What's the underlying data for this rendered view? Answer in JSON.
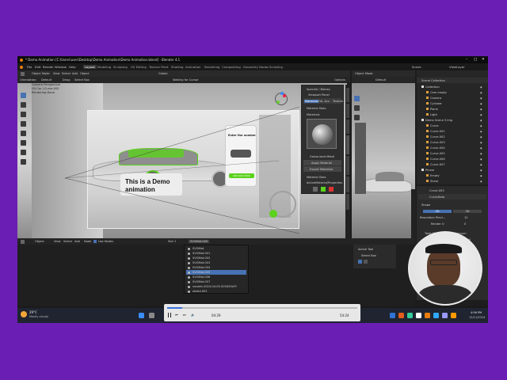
{
  "window": {
    "title": "* Demo Animation [C:\\Users\\user\\Desktop\\Demo Animation\\Demo Animation.blend] - Blender 4.1"
  },
  "menu": {
    "items": [
      "File",
      "Edit",
      "Render",
      "Window",
      "Help"
    ],
    "workspaces": [
      "Layout",
      "Modeling",
      "Sculpting",
      "UV Editing",
      "Texture Paint",
      "Shading",
      "Animation",
      "Rendering",
      "Compositing",
      "Geometry Nodes",
      "Scripting"
    ],
    "scene": "Scene",
    "view_layer": "ViewLayer"
  },
  "viewport": {
    "mode": "Object Mode",
    "menus": [
      "View",
      "Select",
      "Add",
      "Object"
    ],
    "transform": "Global",
    "orientation": "Orientation:",
    "default": "Default",
    "drag": "Drag:",
    "select": "Select Box",
    "overlay_label": "Camera Perspective",
    "collection_label": "(9) Car | Curve.005",
    "rendering": "Rendering Done",
    "waiting": "Waiting for Cursor",
    "options": "Options"
  },
  "scene_overlay": {
    "banner_line1": "This is a Demo",
    "banner_line2": "animation",
    "phone_title": "Enter the number",
    "phone_btn": "000 000 0000"
  },
  "sidebar": {
    "header": "Speckle / Blenso",
    "tabs": [
      "Materials",
      "Viewport Panel"
    ],
    "subtabs": [
      "Materials",
      "Ob. Acc.",
      "Texture"
    ],
    "rows": [
      "Material Slots",
      "Materials"
    ],
    "material_name": "Galvanized Metal",
    "apply": "Apply Material",
    "export": "Export Materials",
    "sections": [
      "Material Slots",
      "ActiveMaterial/Properties"
    ]
  },
  "vtabs": [
    "Item",
    "Tool",
    "View",
    "BlenderKit",
    "Polyhaven",
    "Speckle",
    "Blenso",
    "Create"
  ],
  "outliner": {
    "title": "Scene Collection",
    "items": [
      {
        "name": "Collection",
        "level": 0
      },
      {
        "name": "Cam empty",
        "level": 1
      },
      {
        "name": "Camera",
        "level": 1
      },
      {
        "name": "Cylinder",
        "level": 1
      },
      {
        "name": "Plane",
        "level": 1
      },
      {
        "name": "Light",
        "level": 1
      },
      {
        "name": "Demo Scene 3 Img",
        "level": 0
      },
      {
        "name": "Curve",
        "level": 1
      },
      {
        "name": "Curve.001",
        "level": 1
      },
      {
        "name": "Curve.002",
        "level": 1
      },
      {
        "name": "Curve.003",
        "level": 1
      },
      {
        "name": "Curve.004",
        "level": 1
      },
      {
        "name": "Curve.005",
        "level": 1
      },
      {
        "name": "Curve.006",
        "level": 1
      },
      {
        "name": "Curve.007",
        "level": 1
      },
      {
        "name": "Phone",
        "level": 0
      },
      {
        "name": "Empty",
        "level": 1
      },
      {
        "name": "Shear",
        "level": 1
      }
    ]
  },
  "props": {
    "object": "Curve.005",
    "data": "CurveData",
    "shape": "Shape",
    "fields": [
      {
        "label": "2D",
        "value": "3D"
      },
      {
        "label": "Resolution Previ...",
        "value": "12"
      },
      {
        "label": "Render U",
        "value": "0"
      },
      {
        "label": "Twist Method",
        "value": "Minimum"
      },
      {
        "label": "Smooth",
        "value": "0.00"
      }
    ]
  },
  "lower": {
    "mode": "Object",
    "menus": [
      "View",
      "Select",
      "Add",
      "Node"
    ],
    "use_nodes": "Use Nodes",
    "slot": "Slot 1",
    "list": [
      "SVGMat",
      "SVGMat.001",
      "SVGMat.002",
      "SVGMat.003",
      "SVGMat.004",
      "SVGMat.005",
      "SVGMat.006",
      "SVGMat.007",
      "vscode-2024-04-05-005455d7f",
      "shield.001"
    ],
    "active_tool": "Active Tool",
    "select_box": "Select Box"
  },
  "timeline": {
    "playback": "Playback",
    "keying": "Keying",
    "view": "View",
    "marker": "Marker"
  },
  "statusbar": {
    "select": "Select",
    "rotate": "Rotate View",
    "object": "Object",
    "version": "4.1.1"
  },
  "player": {
    "time": "04:29",
    "total": "54:24"
  },
  "taskbar": {
    "weather_temp": "29°C",
    "weather_desc": "Mostly cloudy",
    "clock": "4:56 PM",
    "date": "12/11/2024"
  },
  "colors": {
    "frame": "#1d1d1d",
    "accent": "#4772b3",
    "green": "#5bd21c",
    "bg": "#6b1eb3"
  }
}
